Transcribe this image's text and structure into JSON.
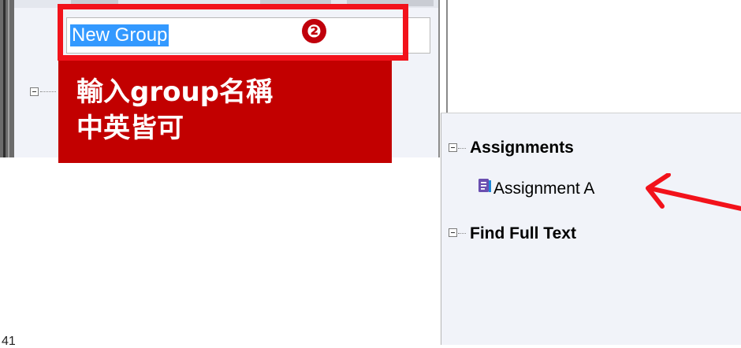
{
  "edit": {
    "value": "New Group"
  },
  "step_badge": "❷",
  "callout": {
    "line1": "輸入group名稱",
    "line2": "中英皆可"
  },
  "tree": {
    "items": [
      {
        "label": "Assignments",
        "type": "group",
        "expanded": true
      },
      {
        "label": "Assignment A",
        "type": "assignment",
        "icon": "assignment-doc-icon"
      },
      {
        "label": "Find Full Text",
        "type": "group",
        "expanded": true
      }
    ]
  },
  "colors": {
    "highlight": "#f2121b",
    "callout_bg": "#c20000",
    "selection": "#3399ff",
    "tree_bg": "#f1f3f9",
    "icon_purple": "#6a4fb0",
    "icon_blue": "#1e88d8"
  },
  "page_number": "41"
}
